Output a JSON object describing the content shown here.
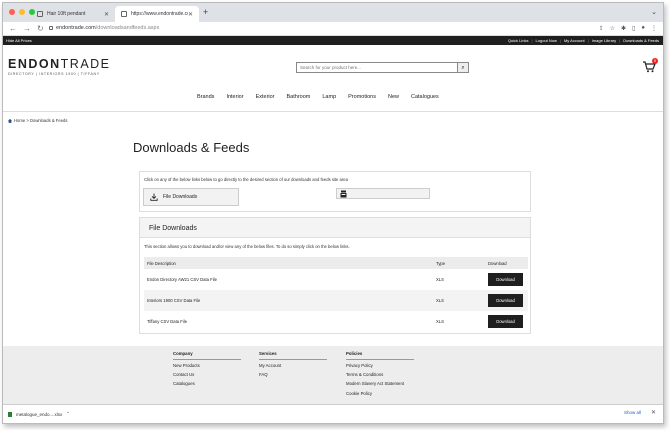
{
  "browser": {
    "tabs": [
      {
        "title": "Hair 10ft pendant"
      },
      {
        "title": "https://www.endontrade.com/"
      }
    ],
    "new_tab": "+",
    "url_domain": "endontrade.com",
    "url_path": "/downloadsandfeeds.aspx"
  },
  "topbar": {
    "hide_prices": "Hide All Prices",
    "links": [
      "Quick Links",
      "Logout Now",
      "My Account",
      "Image Library",
      "Downloads & Feeds"
    ]
  },
  "header": {
    "logo_bold": "ENDON",
    "logo_thin": "TRADE",
    "logo_tagline": "DIRECTORY | INTERIORS 1900 | TIFFANY",
    "search_placeholder": "Search for your product here...",
    "cart_count": "0"
  },
  "nav": [
    "Brands",
    "Interior",
    "Exterior",
    "Bathroom",
    "Lamp",
    "Promotions",
    "New",
    "Catalogues"
  ],
  "breadcrumb": {
    "home": "Home",
    "sep": ">",
    "current": "Downloads & Feeds"
  },
  "page_title": "Downloads & Feeds",
  "hint": {
    "text": "Click on any of the below links below to go directly to the desired section of our downloads and feeds site area",
    "file_downloads": "File Downloads"
  },
  "files": {
    "title": "File Downloads",
    "description": "This section allows you to download and/or view any of the below files. To do so simply click on the below links.",
    "columns": [
      "File Description",
      "Type",
      "Download"
    ],
    "rows": [
      {
        "desc": "Endon Directory AW21 CSV Data File",
        "type": "XLS",
        "button": "Download"
      },
      {
        "desc": "Interiors 1900 CSV Data File",
        "type": "XLS",
        "button": "Download"
      },
      {
        "desc": "Tiffany CSV Data File",
        "type": "XLS",
        "button": "Download"
      }
    ]
  },
  "footer": {
    "company": {
      "heading": "Company",
      "items": [
        "New Products",
        "Contact Us",
        "Catalogues"
      ]
    },
    "services": {
      "heading": "Services",
      "items": [
        "My Account",
        "FAQ"
      ]
    },
    "policies": {
      "heading": "Policies",
      "items": [
        "Privacy Policy",
        "Terms & Conditions",
        "Modern Slavery Act Statement",
        "Cookie Policy"
      ]
    }
  },
  "downloads_bar": {
    "file": "metalogue_endo....xlsx",
    "show_all": "Show all"
  },
  "colors": {
    "brand_dark": "#1f1f1f",
    "badge": "#ee2222",
    "link": "#1a5fd0"
  }
}
